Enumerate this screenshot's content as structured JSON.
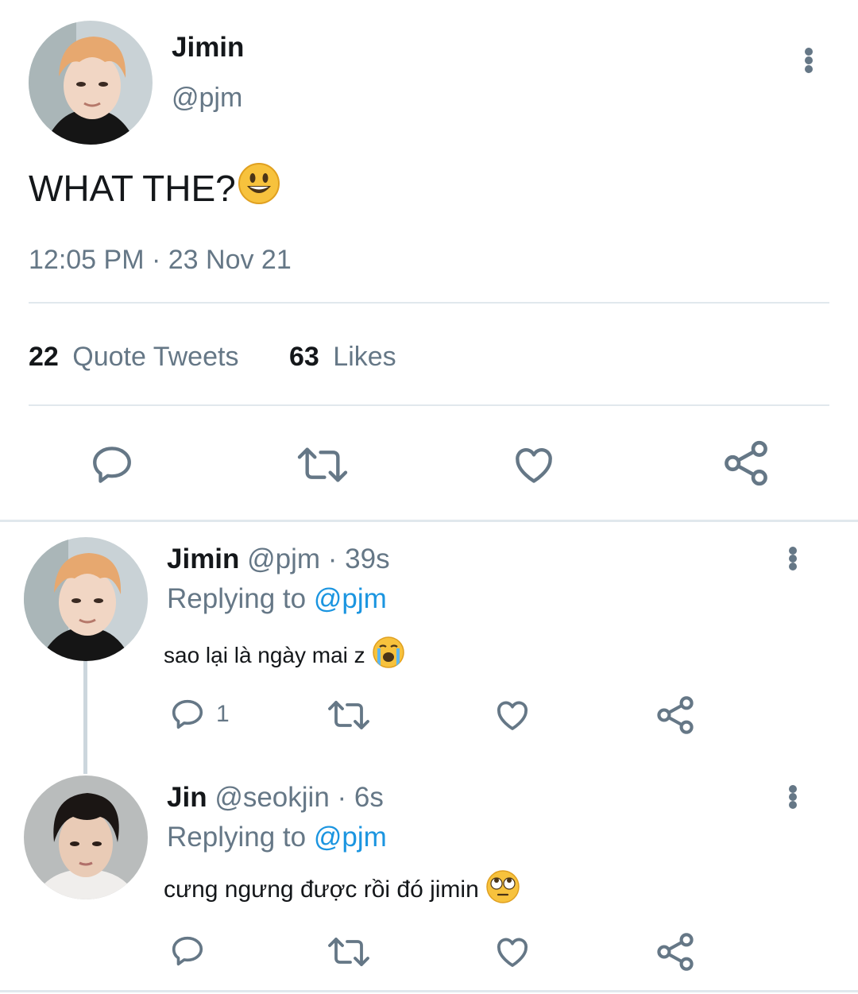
{
  "main_tweet": {
    "name": "Jimin",
    "handle": "@pjm",
    "text": "WHAT THE?",
    "emoji": "grinning-face-emoji",
    "timestamp": "12:05 PM · 23 Nov 21",
    "quote_count": "22",
    "quote_label": "Quote Tweets",
    "like_count": "63",
    "like_label": "Likes"
  },
  "replies": [
    {
      "name": "Jimin",
      "meta": "@pjm · 39s",
      "replying_label": "Replying to",
      "replying_handle": "@pjm",
      "text": "sao lại là ngày mai z",
      "emoji": "loudly-crying-face-emoji",
      "reply_count": "1"
    },
    {
      "name": "Jin",
      "meta": "@seokjin · 6s",
      "replying_label": "Replying to",
      "replying_handle": "@pjm",
      "text": "cưng ngưng được rồi đó jimin",
      "emoji": "face-with-rolling-eyes-emoji",
      "reply_count": ""
    }
  ],
  "colors": {
    "icon_gray": "#657786",
    "link_blue": "#1b95e0",
    "divider": "#e1e8ed"
  }
}
